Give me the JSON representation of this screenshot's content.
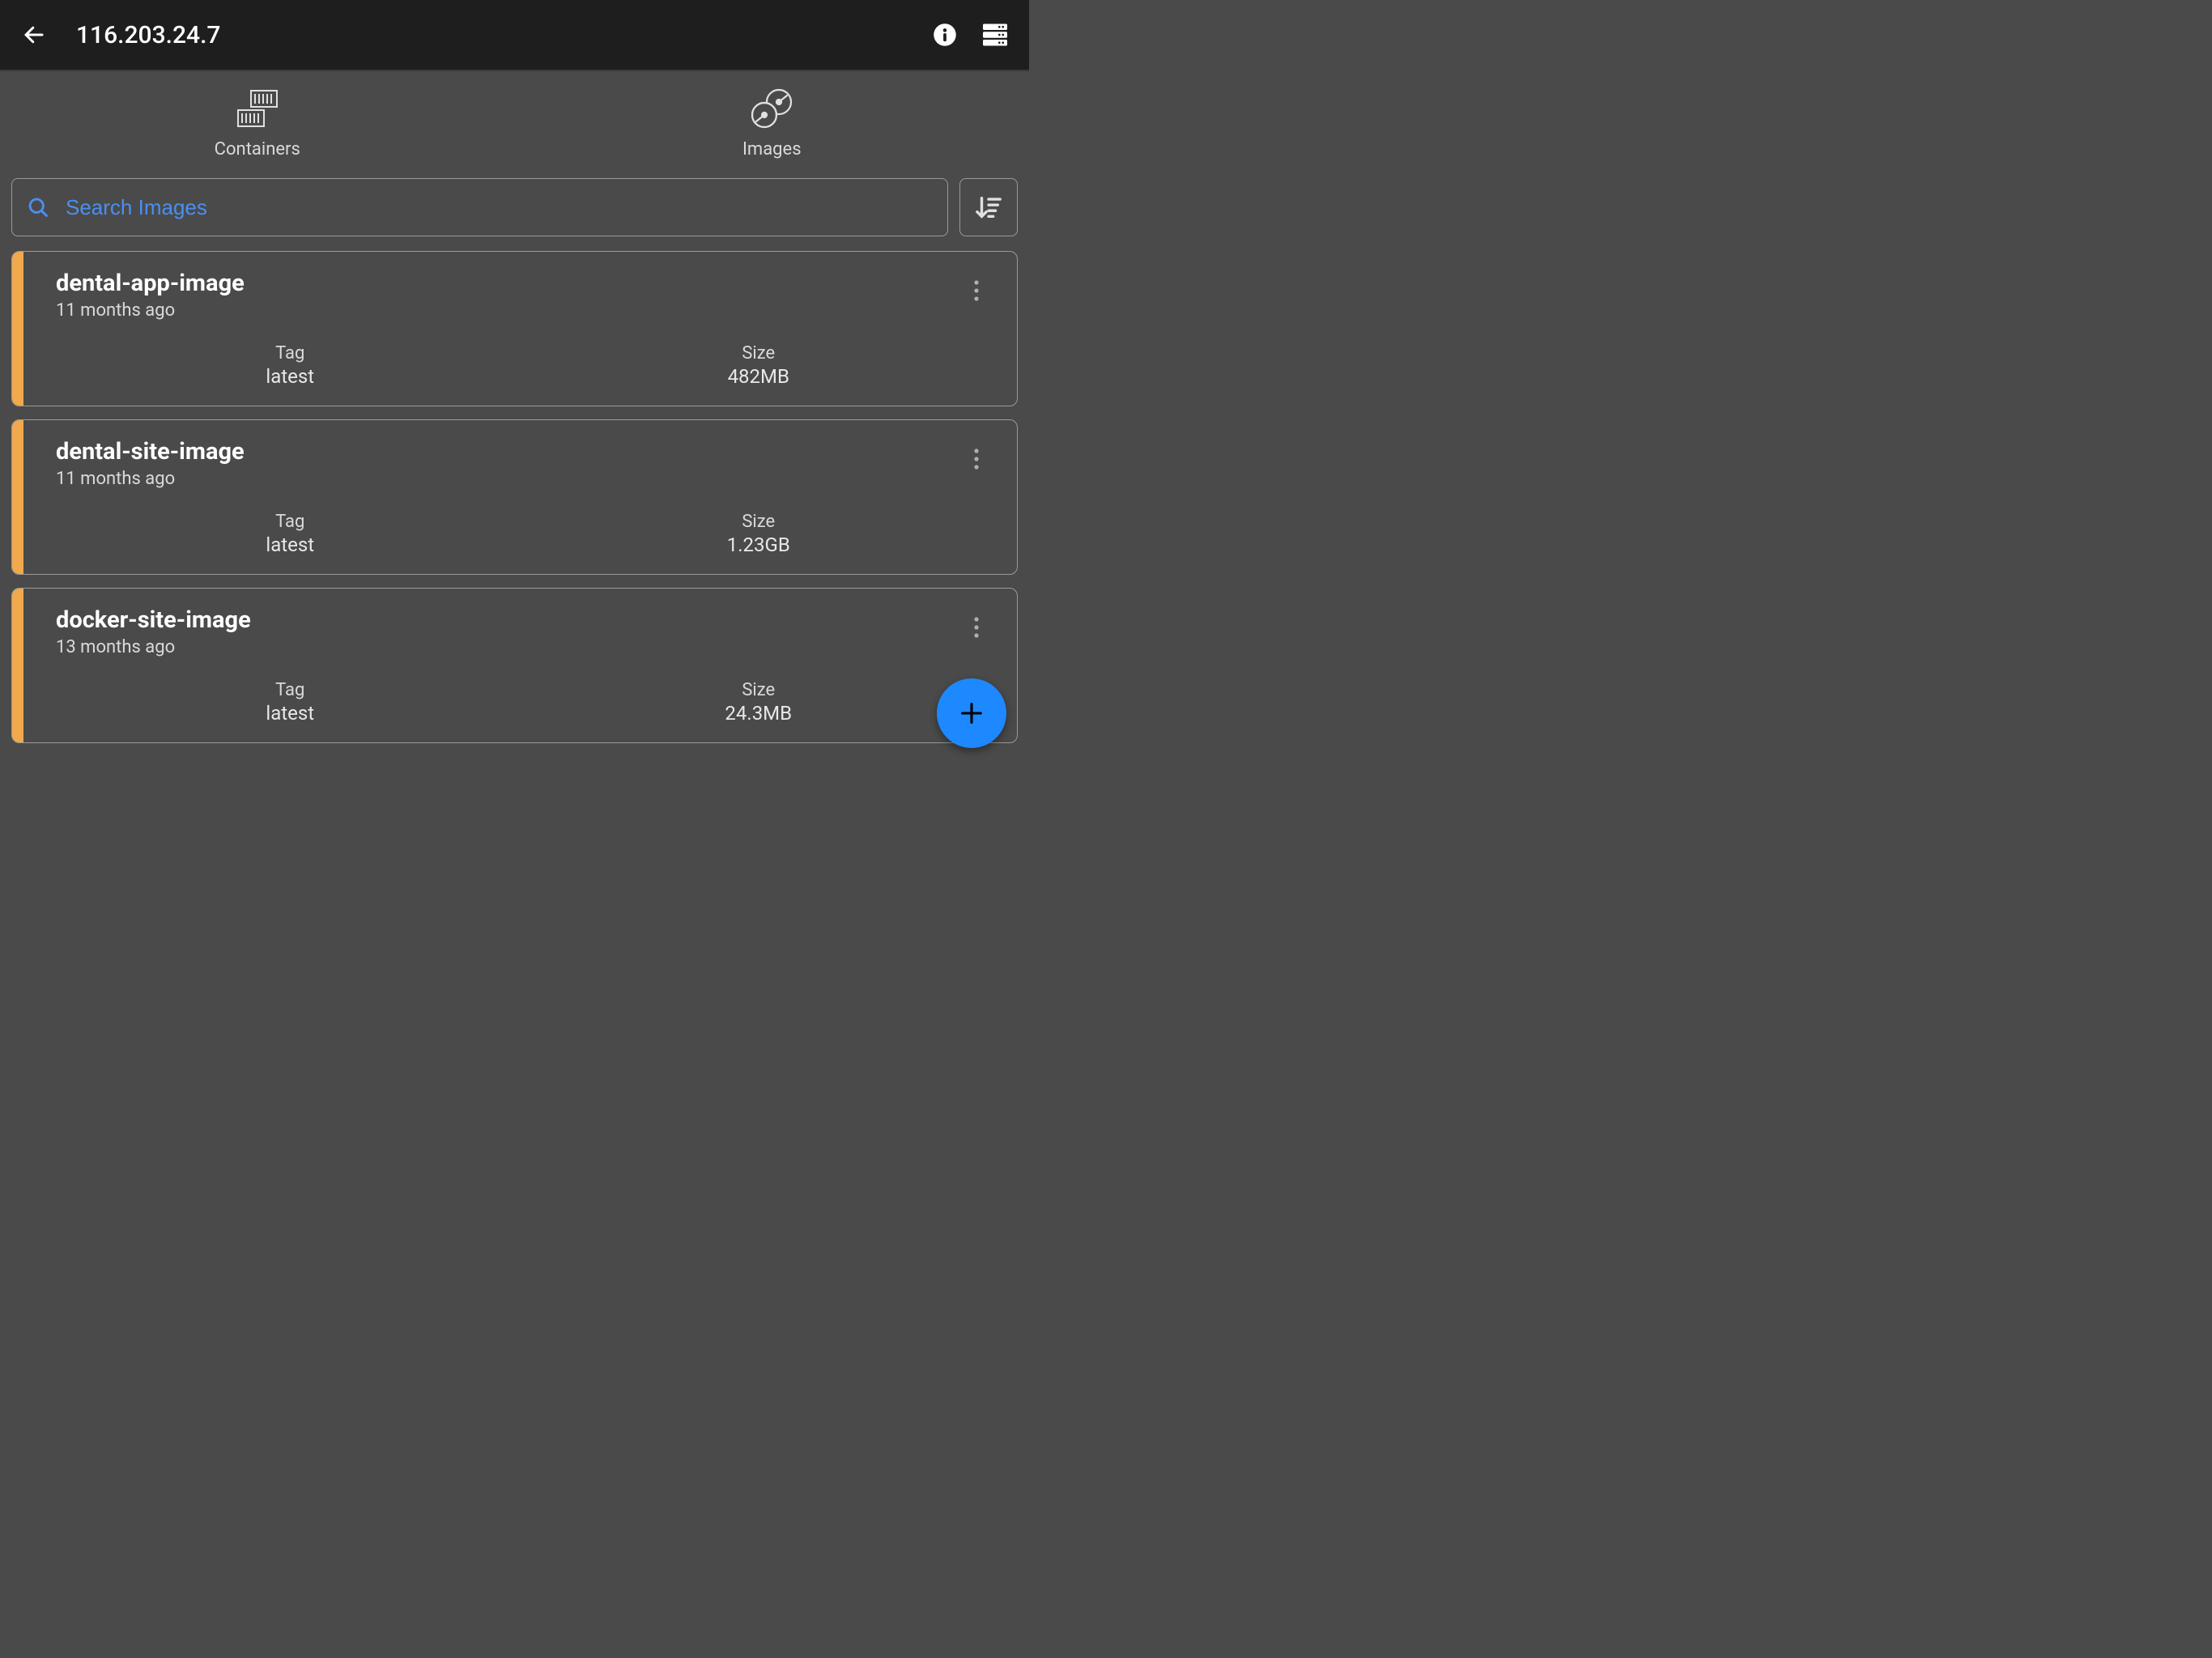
{
  "header": {
    "title": "116.203.24.7"
  },
  "tabs": {
    "containers": "Containers",
    "images": "Images"
  },
  "search": {
    "placeholder": "Search Images"
  },
  "labels": {
    "tag": "Tag",
    "size": "Size"
  },
  "images": [
    {
      "name": "dental-app-image",
      "age": "11 months ago",
      "tag": "latest",
      "size": "482MB"
    },
    {
      "name": "dental-site-image",
      "age": "11 months ago",
      "tag": "latest",
      "size": "1.23GB"
    },
    {
      "name": "docker-site-image",
      "age": "13 months ago",
      "tag": "latest",
      "size": "24.3MB"
    }
  ],
  "colors": {
    "accent_stripe": "#f2a94d",
    "fab": "#1e88ff",
    "search_text": "#4a8ff0"
  }
}
